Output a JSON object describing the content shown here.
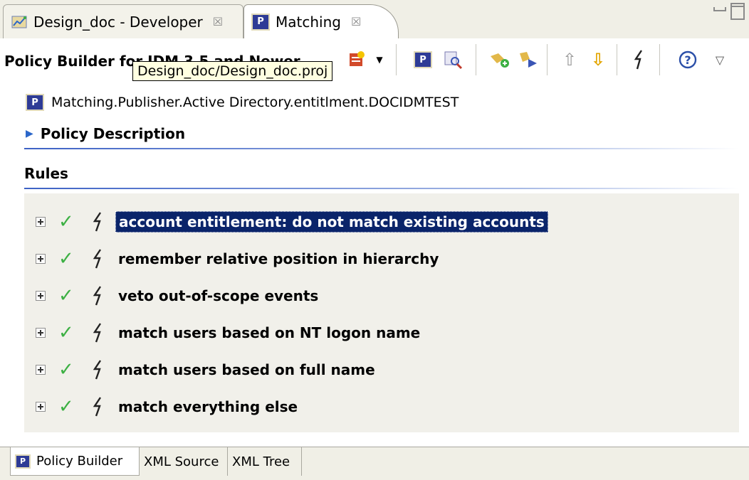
{
  "tabs": [
    {
      "label": "Design_doc - Developer",
      "icon": "developer-perspective-icon",
      "active": false
    },
    {
      "label": "Matching",
      "icon": "policy-icon",
      "active": true
    }
  ],
  "editor": {
    "title": "Policy Builder for IDM 3.5 and Newer",
    "tooltip": "Design_doc/Design_doc.proj"
  },
  "policy": {
    "path": "Matching.Publisher.Active Directory.entitlment.DOCIDMTEST",
    "icon_text": "P"
  },
  "sections": {
    "description": "Policy Description",
    "rules": "Rules"
  },
  "rules": [
    {
      "label": "account entitlement: do not match existing accounts",
      "selected": true
    },
    {
      "label": "remember relative position in hierarchy",
      "selected": false
    },
    {
      "label": "veto out-of-scope events",
      "selected": false
    },
    {
      "label": "match users based on NT logon name",
      "selected": false
    },
    {
      "label": "match users based on full name",
      "selected": false
    },
    {
      "label": "match everything else",
      "selected": false
    }
  ],
  "bottom_tabs": [
    {
      "label": "Policy Builder",
      "active": true
    },
    {
      "label": "XML Source",
      "active": false
    },
    {
      "label": "XML Tree",
      "active": false
    }
  ],
  "colors": {
    "selection": "#0a246a",
    "check": "#3cb043",
    "section_rule": "#3d62c5"
  }
}
